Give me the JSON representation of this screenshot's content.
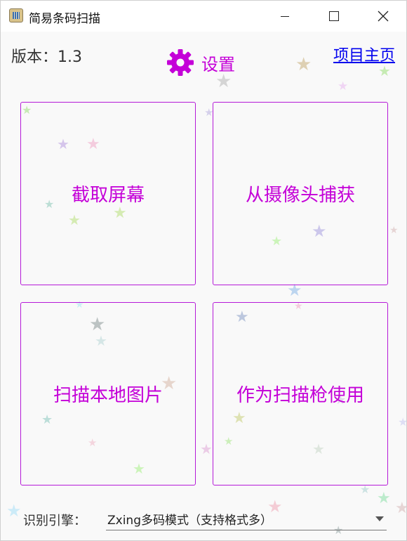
{
  "window": {
    "title": "简易条码扫描"
  },
  "header": {
    "version_label": "版本：1.3",
    "settings_label": "设置",
    "home_link": "项目主页"
  },
  "tiles": [
    {
      "label": "截取屏幕"
    },
    {
      "label": "从摄像头捕获"
    },
    {
      "label": "扫描本地图片"
    },
    {
      "label": "作为扫描枪使用"
    }
  ],
  "footer": {
    "engine_label": "识别引擎：",
    "engine_value": "Zxing多码模式（支持格式多）"
  },
  "colors": {
    "accent": "#c400d8",
    "tile_border": "#b51ad8",
    "link": "#0000ee"
  },
  "icons": {
    "settings": "gear-icon",
    "dropdown": "chevron-down-icon",
    "decoration": "star-icon"
  }
}
